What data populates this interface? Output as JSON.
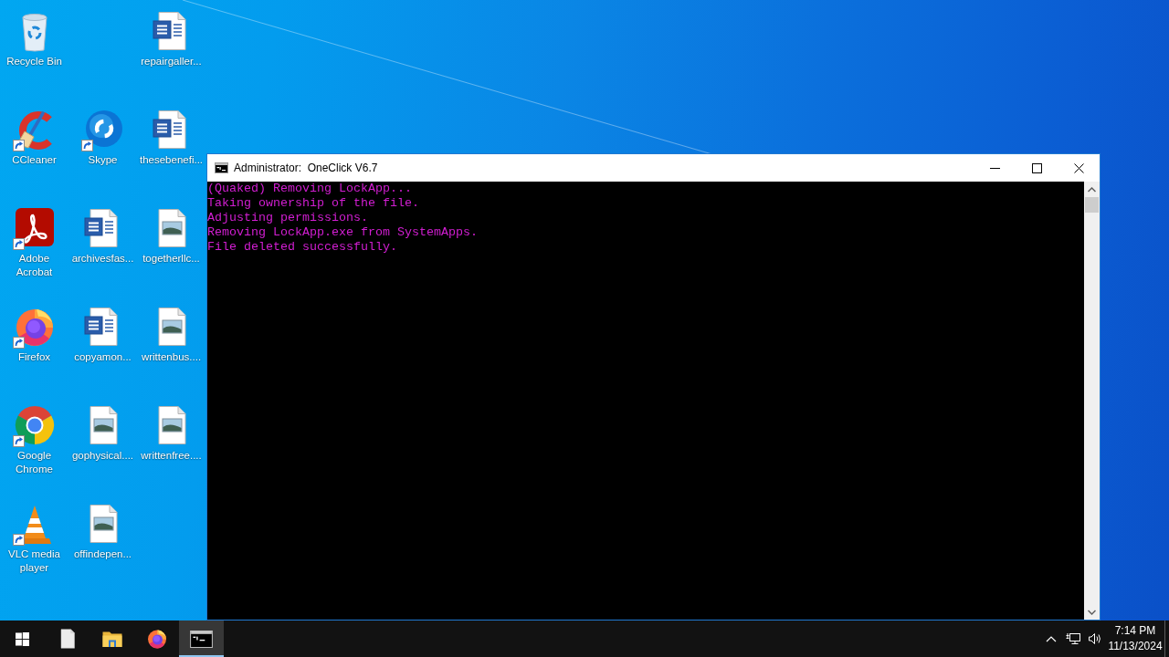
{
  "desktop": {
    "columns": [
      {
        "icons": [
          {
            "label": "Recycle Bin",
            "kind": "recycle-bin",
            "shortcut": false
          },
          {
            "label": "CCleaner",
            "kind": "ccleaner",
            "shortcut": true
          },
          {
            "label": "Adobe Acrobat",
            "kind": "acrobat",
            "shortcut": true
          },
          {
            "label": "Firefox",
            "kind": "firefox",
            "shortcut": true
          },
          {
            "label": "Google Chrome",
            "kind": "chrome",
            "shortcut": true
          },
          {
            "label": "VLC media player",
            "kind": "vlc",
            "shortcut": true
          }
        ]
      },
      {
        "icons": [
          {
            "label": "Skype",
            "kind": "skype",
            "shortcut": true
          },
          {
            "label": "archivesfas...",
            "kind": "word-document",
            "shortcut": false
          },
          {
            "label": "copyamon...",
            "kind": "word-document",
            "shortcut": false
          },
          {
            "label": "gophysical....",
            "kind": "image-file",
            "shortcut": false
          },
          {
            "label": "offindepen...",
            "kind": "image-file",
            "shortcut": false
          }
        ]
      },
      {
        "icons": [
          {
            "label": "repairgaller...",
            "kind": "word-document",
            "shortcut": false
          },
          {
            "label": "thesebenefi...",
            "kind": "word-document",
            "shortcut": false
          },
          {
            "label": "togetherllc...",
            "kind": "image-file",
            "shortcut": false
          },
          {
            "label": "writtenbus....",
            "kind": "image-file",
            "shortcut": false
          },
          {
            "label": "writtenfree....",
            "kind": "image-file",
            "shortcut": false
          }
        ]
      }
    ]
  },
  "console_window": {
    "title": "Administrator:  OneClick V6.7",
    "lines": [
      "(Quaked) Removing LockApp...",
      "Taking ownership of the file.",
      "Adjusting permissions.",
      "Removing LockApp.exe from SystemApps.",
      "File deleted successfully."
    ]
  },
  "taskbar": {
    "apps": [
      {
        "kind": "document",
        "selected": false
      },
      {
        "kind": "file-explorer",
        "selected": false
      },
      {
        "kind": "firefox",
        "selected": false
      },
      {
        "kind": "console",
        "selected": true
      }
    ],
    "clock": {
      "time": "7:14 PM",
      "date": "11/13/2024"
    }
  }
}
